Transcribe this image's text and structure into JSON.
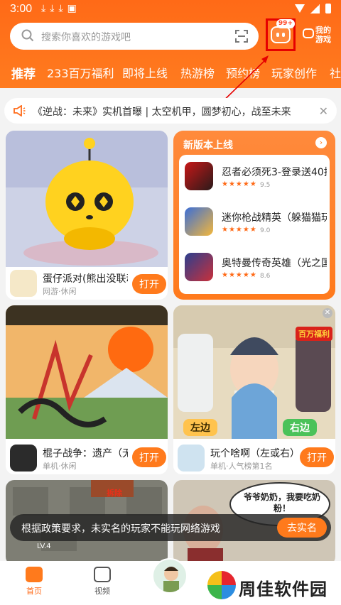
{
  "status_bar": {
    "time": "3:00",
    "left_icons": [
      "download-icon",
      "download-icon",
      "download-icon",
      "app-icon"
    ],
    "right_icons": [
      "wifi-icon",
      "signal-icon",
      "battery-icon"
    ]
  },
  "search": {
    "placeholder": "搜索你喜欢的游戏吧"
  },
  "header": {
    "message_badge": "99+",
    "my_games_label": "我的游戏"
  },
  "tabs": [
    {
      "label": "推荐",
      "active": true
    },
    {
      "label": "233百万福利"
    },
    {
      "label": "即将上线"
    },
    {
      "label": "热游榜"
    },
    {
      "label": "预约榜"
    },
    {
      "label": "玩家创作"
    },
    {
      "label": "社"
    }
  ],
  "notice": {
    "text": "《逆战：未来》实机首曝 | 太空机甲，圆梦初心，战至未来"
  },
  "new_release": {
    "title": "新版本上线",
    "items": [
      {
        "name": "忍者必须死3-登录送40抽",
        "rating": 9.5,
        "rating_text": "9.5"
      },
      {
        "name": "迷你枪战精英（躲猫猫玩…",
        "rating": 9.0,
        "rating_text": "9.0"
      },
      {
        "name": "奥特曼传奇英雄（光之国…",
        "rating": 8.6,
        "rating_text": "8.6"
      }
    ]
  },
  "cards": [
    {
      "title": "蛋仔派对(熊出没联动)",
      "sub": "网游·休闲",
      "button": "打开"
    },
    {
      "title": "棍子战争：遗产（无…",
      "sub": "单机·休闲",
      "button": "打开"
    },
    {
      "title": "玩个啥啊（左或右）",
      "sub": "单机·人气榜第1名",
      "button": "打开"
    }
  ],
  "card_art_text": {
    "left_choice": "左边",
    "right_choice": "右边",
    "promo_badge": "百万福利",
    "speech": "爷爷奶奶，我要吃奶粉！",
    "tag": "拆除",
    "level": "LV.4"
  },
  "toast": {
    "text": "根据政策要求，未实名的玩家不能玩网络游戏",
    "button": "去实名"
  },
  "bottom_nav": [
    {
      "label": "首页",
      "active": true,
      "icon": "home-gamepad-icon"
    },
    {
      "label": "视频",
      "icon": "video-icon"
    }
  ],
  "watermark": "周佳软件园",
  "colors": {
    "accent": "#ff7a1c",
    "header": "#ff6a17",
    "highlight_box": "#e60000"
  }
}
